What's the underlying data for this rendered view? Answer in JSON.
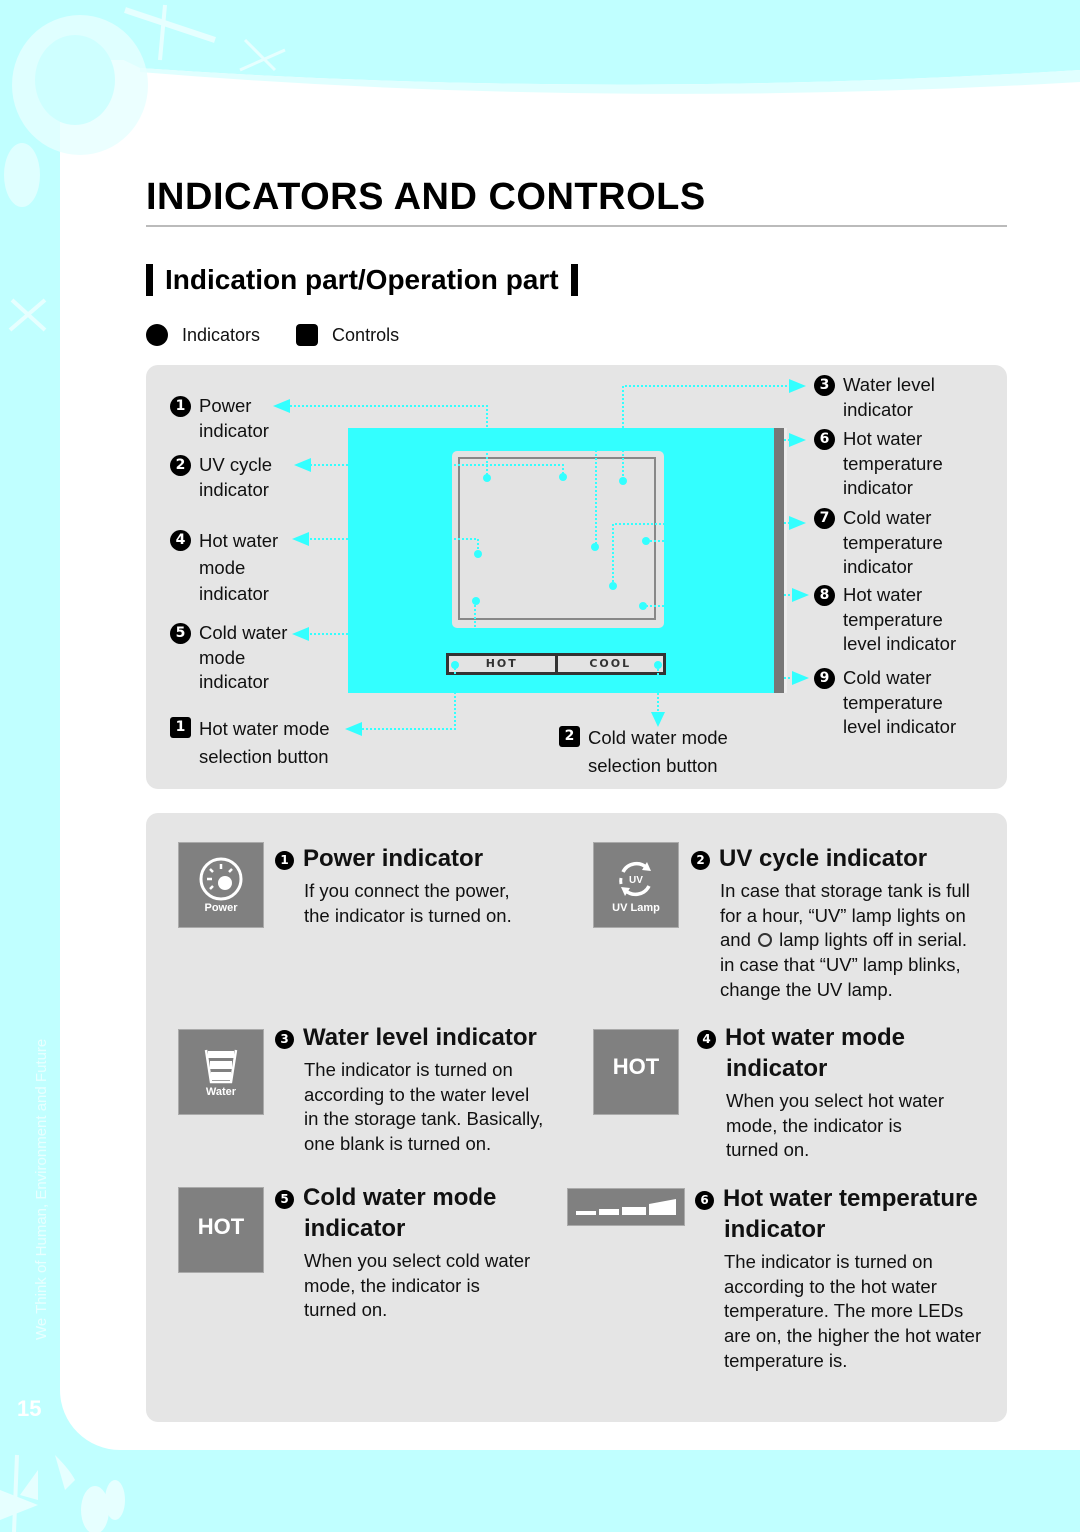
{
  "page": {
    "title": "INDICATORS AND CONTROLS",
    "subtitle": "Indication part/Operation part",
    "side_text": "We Think of Human, Environment and Future",
    "page_number": "15",
    "colors": {
      "background": "#c0ffff",
      "accent_cyan": "#33ffff",
      "panel": "#e5e5e5",
      "icon_gray": "#808080"
    }
  },
  "legend": {
    "indicators": "Indicators",
    "controls": "Controls"
  },
  "diagram": {
    "left_labels": [
      {
        "num": "1",
        "type": "indicator",
        "lines": [
          "Power",
          "indicator"
        ]
      },
      {
        "num": "2",
        "type": "indicator",
        "lines": [
          "UV cycle",
          "indicator"
        ]
      },
      {
        "num": "4",
        "type": "indicator",
        "lines": [
          "Hot water",
          "mode",
          "indicator"
        ]
      },
      {
        "num": "5",
        "type": "indicator",
        "lines": [
          "Cold water",
          "mode",
          "indicator"
        ]
      },
      {
        "num": "1",
        "type": "control",
        "lines": [
          "Hot water mode",
          "selection button"
        ]
      }
    ],
    "right_labels": [
      {
        "num": "3",
        "type": "indicator",
        "lines": [
          "Water level",
          "indicator"
        ]
      },
      {
        "num": "6",
        "type": "indicator",
        "lines": [
          "Hot water",
          "temperature",
          "indicator"
        ]
      },
      {
        "num": "7",
        "type": "indicator",
        "lines": [
          "Cold water",
          "temperature",
          "indicator"
        ]
      },
      {
        "num": "8",
        "type": "indicator",
        "lines": [
          "Hot water",
          "temperature",
          "level indicator"
        ]
      },
      {
        "num": "9",
        "type": "indicator",
        "lines": [
          "Cold water",
          "temperature",
          "level indicator"
        ]
      }
    ],
    "bottom_label": {
      "num": "2",
      "type": "control",
      "lines": [
        "Cold water mode",
        "selection button"
      ]
    },
    "buttons": {
      "hot": "HOT",
      "cool": "COOL"
    }
  },
  "items": [
    {
      "num": "1",
      "icon": "power-icon",
      "icon_caption": "Power",
      "title_lines": [
        "Power indicator"
      ],
      "body": [
        "If you connect the power,",
        "the indicator is turned on."
      ]
    },
    {
      "num": "2",
      "icon": "uv-lamp-icon",
      "icon_caption": "UV Lamp",
      "icon_inner": "UV",
      "title_lines": [
        "UV cycle indicator"
      ],
      "body": [
        "In case that storage tank is full",
        "for a hour, “UV” lamp lights on",
        "and",
        "lamp lights off in serial.",
        "in case that “UV” lamp blinks,",
        "change the UV lamp."
      ]
    },
    {
      "num": "3",
      "icon": "water-level-icon",
      "icon_caption": "Water",
      "title_lines": [
        "Water level indicator"
      ],
      "body": [
        "The indicator is turned on",
        "according to the water level",
        "in the storage tank. Basically,",
        "one blank is turned on."
      ]
    },
    {
      "num": "4",
      "icon": "hot-mode-icon",
      "icon_caption": "HOT",
      "title_lines": [
        "Hot water mode",
        "indicator"
      ],
      "body": [
        "When you select hot water",
        "mode, the indicator is",
        "turned on."
      ]
    },
    {
      "num": "5",
      "icon": "cold-mode-icon",
      "icon_caption": "HOT",
      "title_lines": [
        "Cold water mode",
        "indicator"
      ],
      "body": [
        "When you select cold water",
        "mode, the indicator is",
        "turned on."
      ]
    },
    {
      "num": "6",
      "icon": "temperature-bar-icon",
      "icon_caption": "",
      "title_lines": [
        "Hot water temperature",
        "indicator"
      ],
      "body": [
        "The indicator is turned on",
        "according to the hot water",
        "temperature. The more LEDs",
        "are on, the higher the hot water",
        "temperature is."
      ]
    }
  ]
}
